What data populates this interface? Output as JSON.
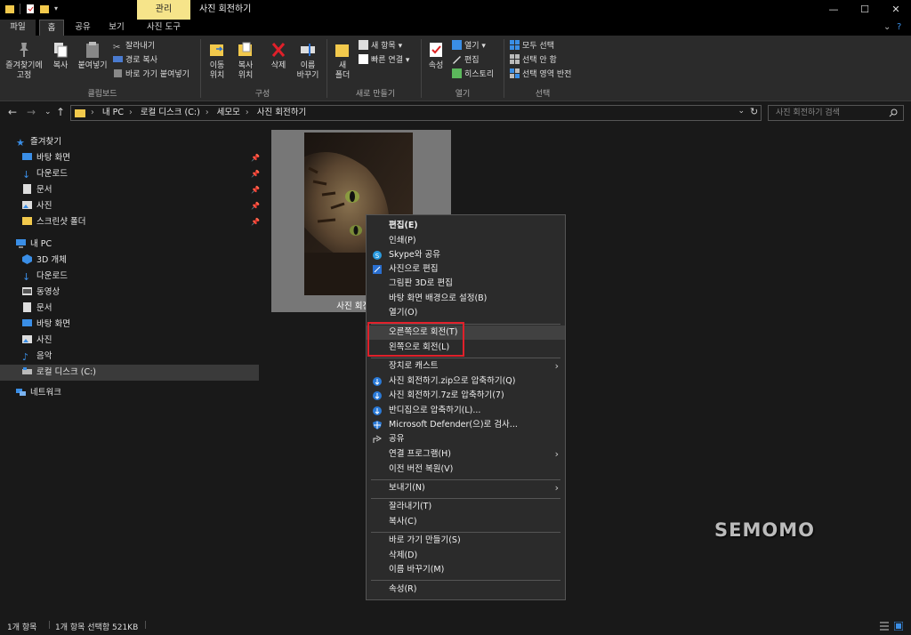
{
  "titlebar": {
    "context_tab": "관리",
    "window_title": "사진 회전하기",
    "minimize": "—",
    "maximize": "☐",
    "close": "✕"
  },
  "tabs": {
    "file": "파일",
    "home": "홈",
    "share": "공유",
    "view": "보기",
    "picture_tools": "사진 도구",
    "collapse": "⌄",
    "help": "?"
  },
  "ribbon": {
    "pin": "즐겨찾기에\n고정",
    "copy": "복사",
    "paste": "붙여넣기",
    "cut": "잘라내기",
    "copy_path": "경로 복사",
    "paste_shortcut": "바로 가기 붙여넣기",
    "group_clipboard": "클립보드",
    "move_to": "이동\n위치",
    "copy_to": "복사\n위치",
    "delete": "삭제",
    "rename": "이름\n바꾸기",
    "group_organize": "구성",
    "new_folder": "새\n폴더",
    "new_item": "새 항목",
    "easy_access": "빠른 연결",
    "group_new": "새로 만들기",
    "properties": "속성",
    "open": "열기",
    "edit": "편집",
    "history": "히스토리",
    "group_open": "열기",
    "select_all": "모두 선택",
    "select_none": "선택 안 함",
    "invert_selection": "선택 영역 반전",
    "group_select": "선택"
  },
  "address": {
    "crumbs": [
      "내 PC",
      "로컬 디스크 (C:)",
      "세모모",
      "사진 회전하기"
    ],
    "search_placeholder": "사진 회전하기 검색"
  },
  "navpane": {
    "quick_access": "즐겨찾기",
    "desktop": "바탕 화면",
    "downloads": "다운로드",
    "documents": "문서",
    "pictures": "사진",
    "screenshots": "스크린샷 폴더",
    "this_pc": "내 PC",
    "objects3d": "3D 개체",
    "pc_downloads": "다운로드",
    "videos": "동영상",
    "pc_documents": "문서",
    "pc_desktop": "바탕 화면",
    "pc_pictures": "사진",
    "music": "음악",
    "local_disk": "로컬 디스크 (C:)",
    "network": "네트워크"
  },
  "content": {
    "file_label": "사진 회전하기",
    "watermark": "SEMOMO"
  },
  "context_menu": {
    "edit": "편집(E)",
    "print": "인쇄(P)",
    "skype": "Skype와 공유",
    "edit_photos": "사진으로 편집",
    "paint3d": "그림판 3D로 편집",
    "set_background": "바탕 화면 배경으로 설정(B)",
    "open": "열기(O)",
    "rotate_right": "오른쪽으로 회전(T)",
    "rotate_left": "왼쪽으로 회전(L)",
    "cast": "장치로 캐스트",
    "zip": "사진 회전하기.zip으로 압축하기(Q)",
    "sevenz": "사진 회전하기.7z로 압축하기(7)",
    "bandizip": "반디집으로 압축하기(L)...",
    "defender": "Microsoft Defender(으)로 검사...",
    "share": "공유",
    "open_with": "연결 프로그램(H)",
    "restore": "이전 버전 복원(V)",
    "send_to": "보내기(N)",
    "cut": "잘라내기(T)",
    "copy": "복사(C)",
    "create_shortcut": "바로 가기 만들기(S)",
    "delete": "삭제(D)",
    "rename": "이름 바꾸기(M)",
    "properties": "속성(R)"
  },
  "status": {
    "count": "1개 항목",
    "selected": "1개 항목 선택함 521KB"
  },
  "colors": {
    "accent_yellow": "#f6e48a",
    "highlight_red": "#e0202a",
    "folder_yellow": "#f2c94c",
    "icon_blue": "#3a8ee6"
  }
}
